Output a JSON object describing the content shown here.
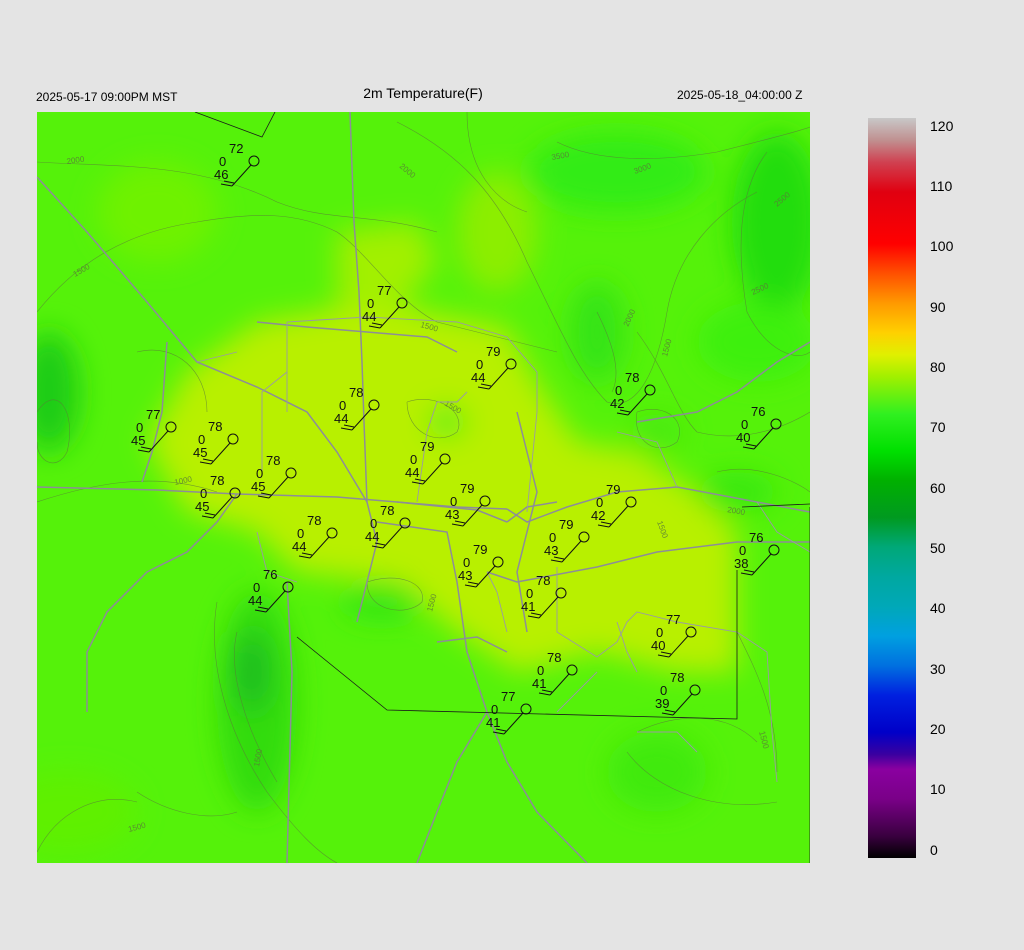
{
  "header": {
    "left_time": "2025-05-17 09:00PM MST",
    "title": "2m Temperature(F)",
    "right_time": "2025-05-18_04:00:00 Z"
  },
  "colorbar": {
    "labels": [
      "120",
      "110",
      "100",
      "90",
      "80",
      "70",
      "60",
      "50",
      "40",
      "30",
      "20",
      "10",
      "0"
    ]
  },
  "contours": [
    "2000",
    "1500",
    "1000",
    "2000",
    "3500",
    "3000",
    "2500",
    "2000",
    "2500",
    "1500",
    "1500",
    "1500",
    "1500",
    "1500",
    "2000",
    "1500",
    "1500",
    "1500"
  ],
  "stations": [
    {
      "t": "72",
      "p": "0",
      "d": "46"
    },
    {
      "t": "77",
      "p": "0",
      "d": "44"
    },
    {
      "t": "79",
      "p": "0",
      "d": "44"
    },
    {
      "t": "78",
      "p": "0",
      "d": "42"
    },
    {
      "t": "78",
      "p": "0",
      "d": "44"
    },
    {
      "t": "77",
      "p": "0",
      "d": "45"
    },
    {
      "t": "78",
      "p": "0",
      "d": "45"
    },
    {
      "t": "76",
      "p": "0",
      "d": "40"
    },
    {
      "t": "79",
      "p": "0",
      "d": "44"
    },
    {
      "t": "78",
      "p": "0",
      "d": "45"
    },
    {
      "t": "78",
      "p": "0",
      "d": "45"
    },
    {
      "t": "79",
      "p": "0",
      "d": "43"
    },
    {
      "t": "78",
      "p": "0",
      "d": "44"
    },
    {
      "t": "79",
      "p": "0",
      "d": "42"
    },
    {
      "t": "79",
      "p": "0",
      "d": "43"
    },
    {
      "t": "78",
      "p": "0",
      "d": "44"
    },
    {
      "t": "76",
      "p": "0",
      "d": "38"
    },
    {
      "t": "79",
      "p": "0",
      "d": "43"
    },
    {
      "t": "76",
      "p": "0",
      "d": "44"
    },
    {
      "t": "78",
      "p": "0",
      "d": "41"
    },
    {
      "t": "77",
      "p": "0",
      "d": "40"
    },
    {
      "t": "78",
      "p": "0",
      "d": "41"
    },
    {
      "t": "78",
      "p": "0",
      "d": "39"
    },
    {
      "t": "77",
      "p": "0",
      "d": "41"
    }
  ]
}
